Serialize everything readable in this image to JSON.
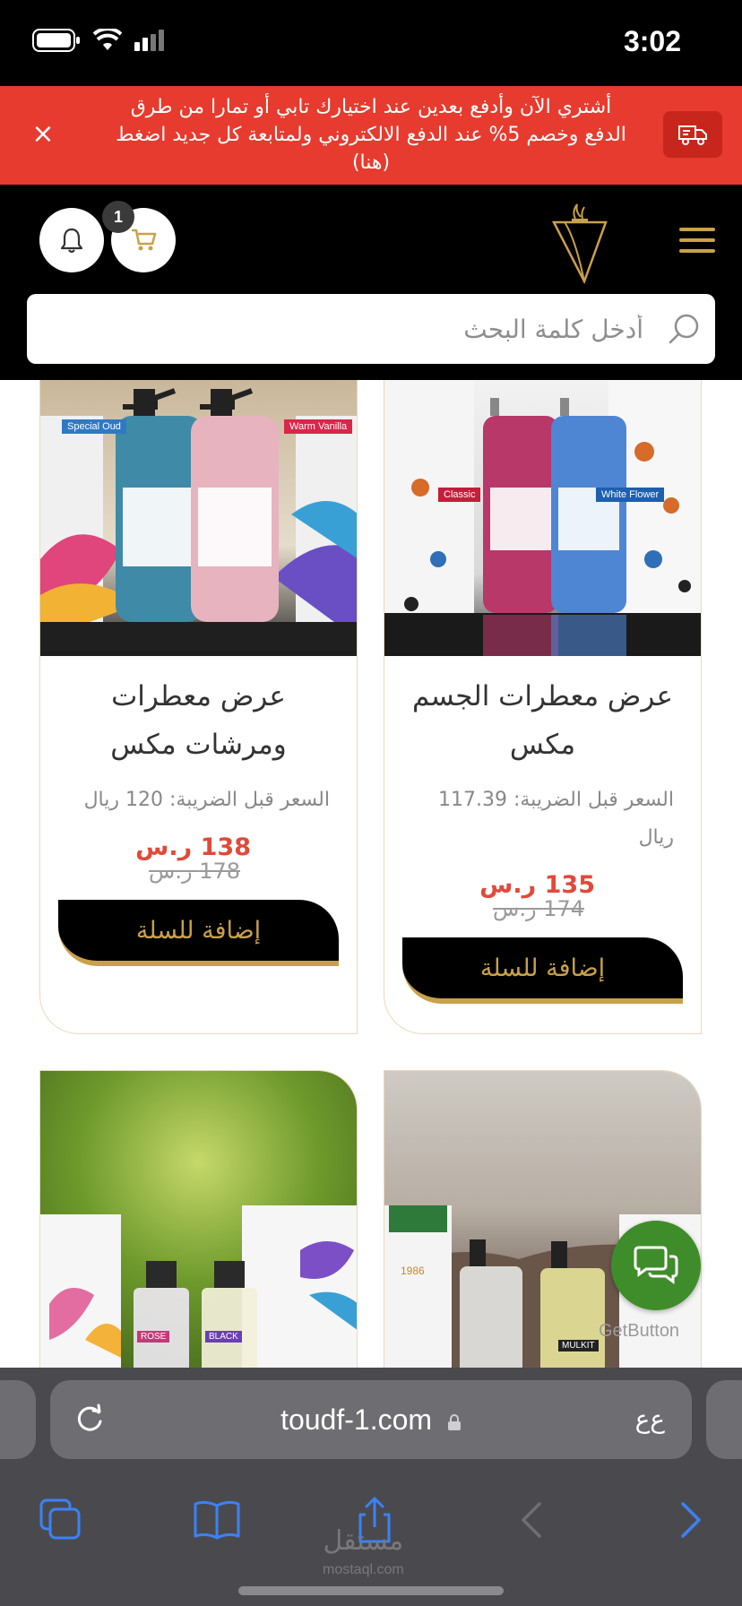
{
  "status_bar": {
    "time": "3:02"
  },
  "promo": {
    "text": "أشتري الآن وأدفع بعدين عند اختيارك تابي أو تمارا من طرق الدفع وخصم 5% عند الدفع الالكتروني ولمتابعة كل جديد اضغط (هنا)",
    "close_label": "×"
  },
  "header": {
    "cart_count": "1",
    "search_placeholder": "أدخل كلمة البحث"
  },
  "products": [
    {
      "title": "عرض معطرات الجسم مكس",
      "price_note": "السعر قبل الضريبة: 117.39 ريال",
      "price": "135 ر.س",
      "old_price": "174 ر.س",
      "button": "إضافة للسلة",
      "label_left": "Classic",
      "label_right": "White Flower"
    },
    {
      "title": "عرض معطرات ومرشات مكس",
      "price_note": "السعر قبل الضريبة: 120 ريال",
      "price": "138 ر.س",
      "old_price": "178 ر.س",
      "button": "إضافة للسلة",
      "label_left": "Special Oud",
      "label_right": "Warm Vanilla"
    },
    {
      "label_left": "1986",
      "label_right": "MULKIT"
    },
    {
      "label_left": "ROSE",
      "label_right": "BLACK"
    }
  ],
  "chat": {
    "label": "GetButton"
  },
  "browser": {
    "url": "toudf-1.com",
    "text_size_label": "ﻉﻉ"
  },
  "watermark": {
    "arabic": "مستقل",
    "latin": "mostaql.com"
  },
  "colors": {
    "promo": "#e63b2e",
    "gold": "#c9a14a",
    "price_red": "#e04a3a",
    "chat_green": "#3f8d2a"
  }
}
